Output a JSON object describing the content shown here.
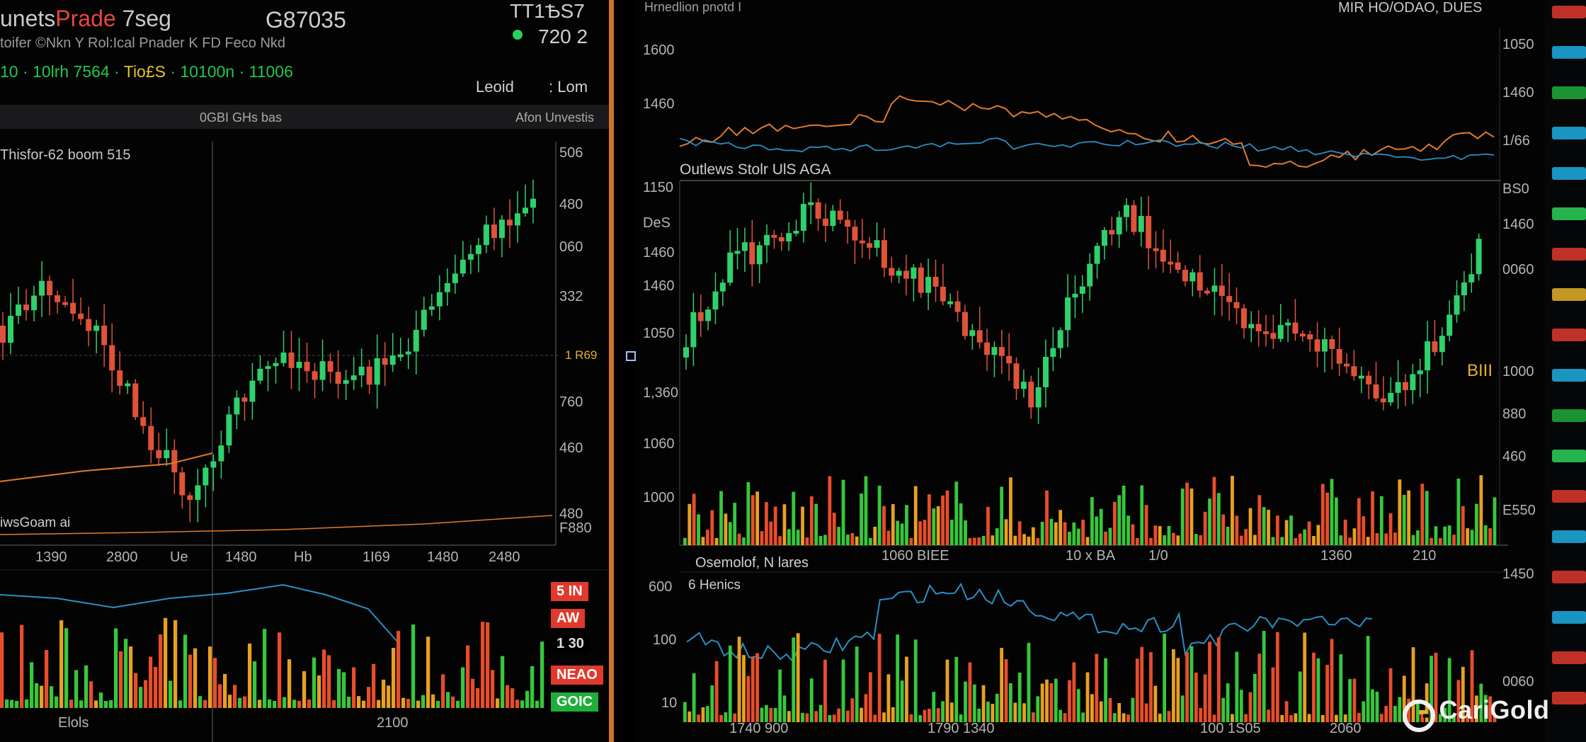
{
  "header": {
    "title_prefix": "unets",
    "title_accent": "Prade",
    "title_suffix": " 7seg",
    "price": "G87035",
    "subtitle": "toifer  ©Nkn   Y    Rol:Ical Pnader    K    FD    Feco Nkd",
    "ticker_green": "10 · 10lrh 7564 · ",
    "ticker_yellow": "Tio£S",
    "ticker_green2": " · 10100n · 11006",
    "top_right_code": "TT1ѢS7",
    "top_right_value": "720 2",
    "legend_left": "Leoid",
    "legend_right": "Lom"
  },
  "left_panel": {
    "bar_label": "0GBI GHs bas",
    "bar_right": "Afon Unvestis",
    "chart_title": "Thisfor-62 boom 515",
    "overlay_label": "iwsGoam ai",
    "current_price": "1 R69",
    "y_ticks": [
      "506",
      "480",
      "060",
      "332",
      "760",
      "460",
      "480",
      "F880"
    ],
    "x_ticks": [
      "1390",
      "2800",
      "Ue",
      "1480",
      "Hb",
      "1I69",
      "1480",
      "2480"
    ],
    "bottom_labels": [
      "Elols",
      "2100"
    ],
    "side_badges": [
      {
        "text": "5 IN",
        "color": "#e03a2c"
      },
      {
        "text": "AW",
        "color": "#e03a2c"
      },
      {
        "text": "1 30",
        "color": "#000000"
      },
      {
        "text": "NEAO",
        "color": "#e03a2c"
      },
      {
        "text": "GOIC",
        "color": "#1fae3a"
      }
    ]
  },
  "right_panel": {
    "top_left": "Hrnedlion pnotd   I",
    "top_right": "MIR HO/ODAO, DUES",
    "overlay_title": "Outlews Stolr UlS AGA",
    "oscillator_label": "Osemolof, N lares",
    "oscillator_sublabel": "6 Henics",
    "marker": "BIII",
    "y_ticks_left": [
      "1600",
      "1460",
      "1150",
      "DeS",
      "1460",
      "1460",
      "1050",
      "1,360",
      "1060",
      "1000"
    ],
    "y_ticks_right": [
      "1050",
      "1460",
      "1/66",
      "BS0",
      "1460",
      "0060",
      "1000",
      "880",
      "460",
      "E550",
      "1450",
      "0060"
    ],
    "x_ticks": [
      "1060 BIEE",
      "10 x BA",
      "1/0",
      "1360",
      "210"
    ],
    "osc_ticks": [
      "600",
      "100",
      "10"
    ],
    "osc_x_ticks": [
      "1740  900",
      "1790  1340",
      "100 1S05",
      "2060"
    ]
  },
  "logo": {
    "name": "CariGold"
  },
  "colors": {
    "up": "#2ed16a",
    "down": "#e0523a",
    "vol_up": "#35c83b",
    "vol_down": "#e84d2a",
    "vol_amber": "#e8a020",
    "line_blue": "#2b8ec4",
    "line_orange": "#e07a2a",
    "divider": "#c9752a"
  }
}
